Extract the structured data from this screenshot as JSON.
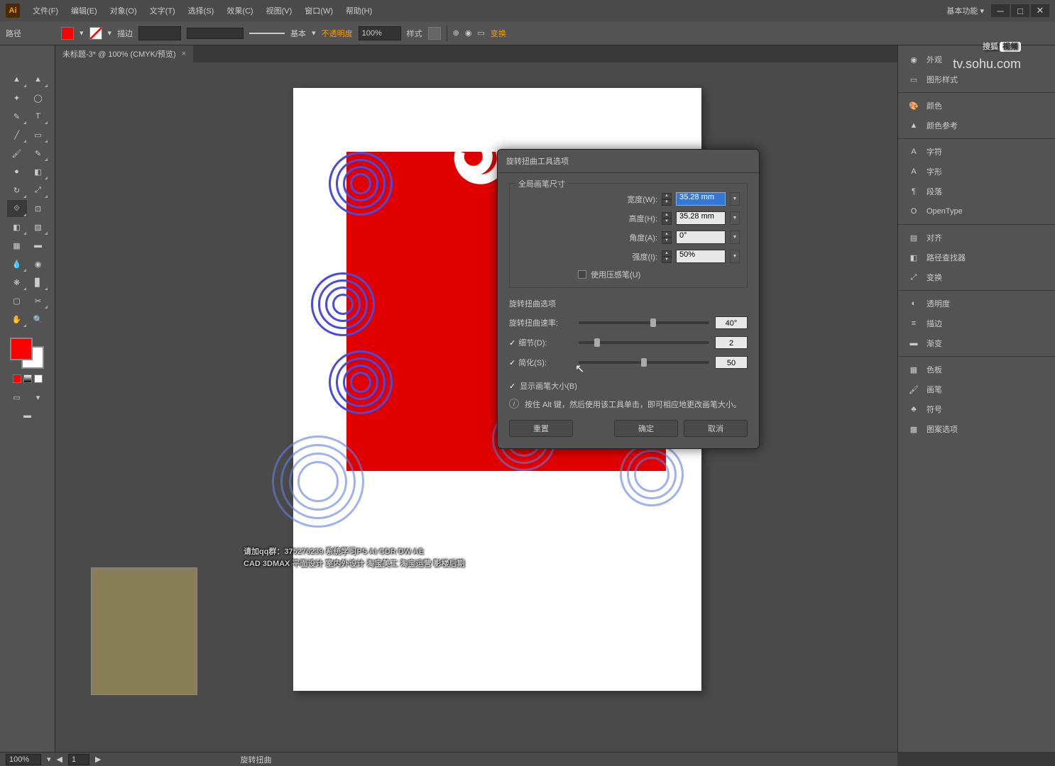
{
  "app": {
    "logo": "Ai",
    "workspace_label": "基本功能"
  },
  "menus": [
    "文件(F)",
    "编辑(E)",
    "对象(O)",
    "文字(T)",
    "选择(S)",
    "效果(C)",
    "视图(V)",
    "窗口(W)",
    "帮助(H)"
  ],
  "optbar": {
    "selection": "路径",
    "stroke_label": "描边",
    "stroke_weight": "",
    "profile": "基本",
    "opacity_label": "不透明度",
    "opacity": "100%",
    "style_label": "样式",
    "transform_label": "变换"
  },
  "tab": {
    "label": "未标题-3* @ 100% (CMYK/预览)"
  },
  "panels": [
    "外观",
    "图形样式",
    "颜色",
    "颜色参考",
    "字符",
    "字形",
    "段落",
    "OpenType",
    "对齐",
    "路径查找器",
    "变换",
    "透明度",
    "描边",
    "渐变",
    "色板",
    "画笔",
    "符号",
    "图案选项"
  ],
  "statusbar": {
    "zoom": "100%",
    "page": "1",
    "tool": "旋转扭曲"
  },
  "dialog": {
    "title": "旋转扭曲工具选项",
    "group_brush": "全局画笔尺寸",
    "width_label": "宽度(W):",
    "width_value": "35.28 mm",
    "height_label": "高度(H):",
    "height_value": "35.28 mm",
    "angle_label": "角度(A):",
    "angle_value": "0°",
    "intensity_label": "强度(I):",
    "intensity_value": "50%",
    "pressure_label": "使用压感笔(U)",
    "group_twirl": "旋转扭曲选项",
    "rate_label": "旋转扭曲速率:",
    "rate_value": "40°",
    "detail_label": "细节(D):",
    "detail_value": "2",
    "simplify_label": "简化(S):",
    "simplify_value": "50",
    "show_brush_label": "显示画笔大小(B)",
    "info": "按住 Alt 键，然后使用该工具单击，即可相应地更改画笔大小。",
    "reset": "重置",
    "ok": "确定",
    "cancel": "取消"
  },
  "overlay": {
    "line1": "请加qq群：375276239 系统学习PS AI CDR DW AE",
    "line2": "CAD 3DMAX 平面设计 室内外设计 淘宝美工 淘宝运营 影楼后期"
  },
  "sohu": {
    "brand1": "搜狐",
    "brand2": "视频",
    "url": "tv.sohu.com"
  }
}
